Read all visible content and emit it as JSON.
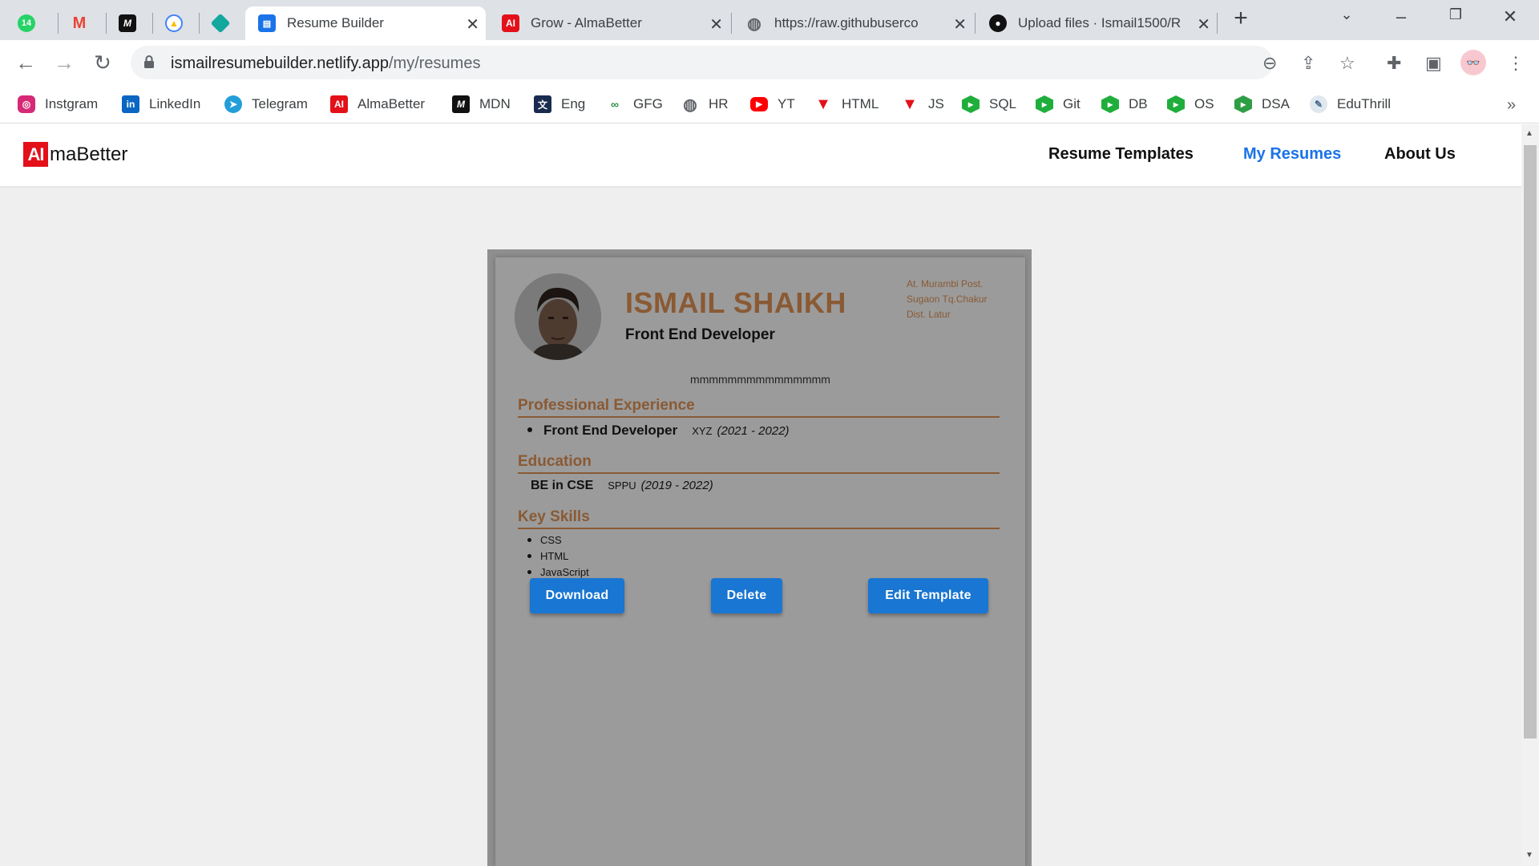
{
  "browser": {
    "pinned_tabs": [
      {
        "icon": "whatsapp-icon",
        "badge": "14",
        "color": "#25d366"
      },
      {
        "icon": "gmail-icon",
        "color": "#ea4335"
      },
      {
        "icon": "medium-icon",
        "color": "#111111"
      },
      {
        "icon": "firebase-icon",
        "color": "#4285f4"
      },
      {
        "icon": "diamond-icon",
        "color": "#12a89d"
      }
    ],
    "tabs": [
      {
        "title": "Resume Builder",
        "icon": "document-icon",
        "active": true
      },
      {
        "title": "Grow - AlmaBetter",
        "icon": "almabetter-icon",
        "active": false
      },
      {
        "title": "https://raw.githubuserco",
        "icon": "globe-icon",
        "active": false
      },
      {
        "title": "Upload files · Ismail1500/R",
        "icon": "github-icon",
        "active": false
      }
    ],
    "url_host": "ismailresumebuilder.netlify.app",
    "url_path": "/my/resumes",
    "bookmarks": [
      {
        "label": "Instgram",
        "icon": "instagram-icon",
        "color": "#d62976"
      },
      {
        "label": "LinkedIn",
        "icon": "linkedin-icon",
        "color": "#0a66c2"
      },
      {
        "label": "Telegram",
        "icon": "telegram-icon",
        "color": "#229ed9"
      },
      {
        "label": "AlmaBetter",
        "icon": "almabetter-icon",
        "color": "#e3101a"
      },
      {
        "label": "MDN",
        "icon": "mdn-icon",
        "color": "#111111"
      },
      {
        "label": "Eng",
        "icon": "translate-icon",
        "color": "#1a2b50"
      },
      {
        "label": "GFG",
        "icon": "gfg-icon",
        "color": "#2f8d46"
      },
      {
        "label": "HR",
        "icon": "globe-icon",
        "color": "#5f6368"
      },
      {
        "label": "YT",
        "icon": "youtube-icon",
        "color": "#ff0000"
      },
      {
        "label": "HTML",
        "icon": "tinyurl-icon",
        "color": "#e3101a"
      },
      {
        "label": "JS",
        "icon": "tinyurl-icon",
        "color": "#e3101a"
      },
      {
        "label": "SQL",
        "icon": "shield-icon",
        "color": "#1fae3b"
      },
      {
        "label": "Git",
        "icon": "shield-icon",
        "color": "#1fae3b"
      },
      {
        "label": "DB",
        "icon": "shield-icon",
        "color": "#1fae3b"
      },
      {
        "label": "OS",
        "icon": "shield-icon",
        "color": "#1fae3b"
      },
      {
        "label": "DSA",
        "icon": "dsa-icon",
        "color": "#2e9e44"
      },
      {
        "label": "EduThrill",
        "icon": "eduthrill-icon",
        "color": "#8aa0b5"
      }
    ]
  },
  "site": {
    "logo_mark": "AI",
    "logo_word": "maBetter",
    "nav": [
      {
        "label": "Resume Templates",
        "active": false
      },
      {
        "label": "My Resumes",
        "active": true
      },
      {
        "label": "About Us",
        "active": false
      }
    ],
    "accent": "#1a73e8"
  },
  "resume": {
    "name": "ISMAIL SHAIKH",
    "title": "Front End Developer",
    "address": [
      "At. Murambi Post.",
      "Sugaon Tq.Chakur",
      "Dist. Latur"
    ],
    "summary": "mmmmmmmmmmmmmmm",
    "sections": {
      "experience": "Professional Experience",
      "education": "Education",
      "skills": "Key Skills"
    },
    "experience": [
      {
        "role": "Front End Developer",
        "org": "XYZ",
        "dates": "(2021 - 2022)"
      }
    ],
    "education": [
      {
        "degree": "BE in CSE",
        "org": "SPPU",
        "dates": "(2019 - 2022)"
      }
    ],
    "skills": [
      "CSS",
      "HTML",
      "JavaScript"
    ],
    "heading_color": "#8a5a34"
  },
  "actions": {
    "download": "Download",
    "delete": "Delete",
    "edit": "Edit Template",
    "color": "#1976d2"
  }
}
